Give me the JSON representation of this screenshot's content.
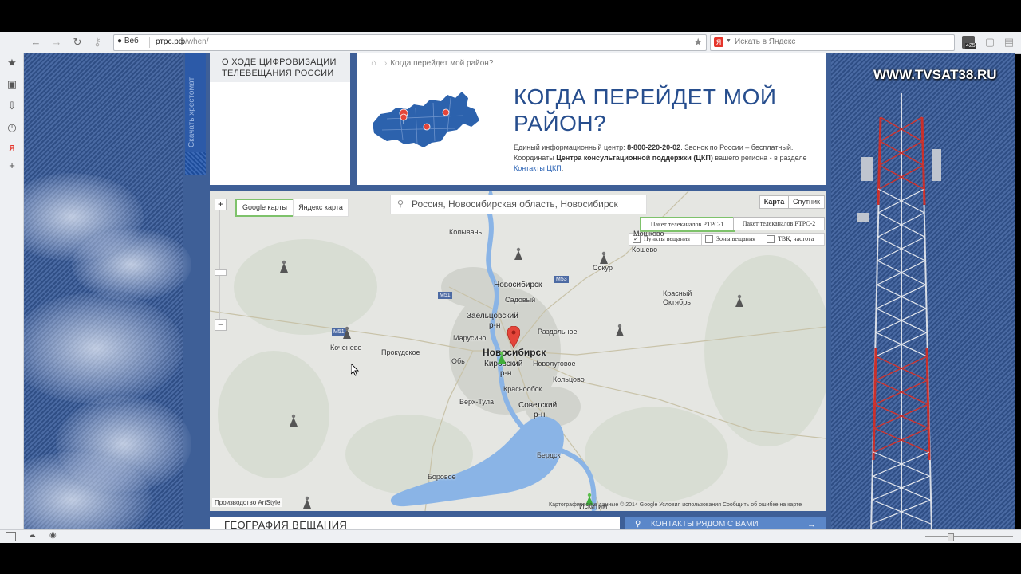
{
  "browser": {
    "web_label": "Веб",
    "url_domain": "ртрс.рф",
    "url_path": "/when/",
    "search_placeholder": "Искать в Яндекс",
    "badge_count": "425"
  },
  "page": {
    "vertical_tab": "Скачать хрестомат",
    "left_header": "О ходе цифровизации телевещания России",
    "breadcrumb": "Когда перейдет мой район?",
    "title": "Когда перейдет мой район?",
    "info_prefix": "Единый информационный центр: ",
    "info_phone": "8-800-220-20-02",
    "info_mid": ". Звонок по России – бесплатный. Координаты ",
    "info_bold": "Центра консультационной поддержки (ЦКП)",
    "info_suffix": " вашего региона - в разделе ",
    "info_link": "Контакты ЦКП",
    "info_end": "."
  },
  "map": {
    "google_label": "Google карты",
    "yandex_label": "Яндекс карта",
    "search_value": "Россия, Новосибирская область, Новосибирск",
    "type_map": "Карта",
    "type_satellite": "Спутник",
    "package1": "Пакет телеканалов РТРС-1",
    "package2": "Пакет телеканалов РТРС-2",
    "chk_points": "Пункты вещания",
    "chk_zones": "Зоны вещания",
    "chk_tvk": "ТВК, частота",
    "copyleft": "Производство ArtStyle",
    "copyright": "Картографические данные © 2014 Google     Условия использования     Сообщить об ошибке на карте",
    "cities": {
      "kolyvan": "Колывань",
      "moshkovo": "Мошково",
      "kosheyo": "Кошево",
      "novosibirsk_top": "Новосибирск",
      "sadovy": "Садовый",
      "sokur": "Сокур",
      "krasny": "Красный",
      "oktyabr": "Октябрь",
      "zaeltsovsky": "Заельцовский",
      "rn1": "р-н",
      "marusino": "Марусино",
      "razdolnoe": "Раздольное",
      "kochenevo": "Коченево",
      "prokudskoe": "Прокудское",
      "novosibirsk": "Новосибирск",
      "kirovsky": "Кировский",
      "rn2": "р-н",
      "ob": "Обь",
      "novolugovoe": "Новолуговое",
      "koltsovo": "Кольцово",
      "krasnoobsk": "Краснообск",
      "verkhtula": "Верх-Тула",
      "sovetsky": "Советский",
      "rn3": "р-н",
      "berdsk": "Бердск",
      "borovoe": "Боровое",
      "iskitim": "Искитим"
    },
    "roads": {
      "m51a": "M51",
      "m53": "M53",
      "m51b": "M51"
    }
  },
  "bottom": {
    "geo_title": "География вещания",
    "contacts": "Контакты рядом с вами"
  },
  "watermark": "WWW.TVSAT38.RU",
  "colors": {
    "accent": "#274e8e",
    "link": "#2b63b5",
    "green_active": "#7ec26b",
    "marker_red": "#e4453a"
  }
}
